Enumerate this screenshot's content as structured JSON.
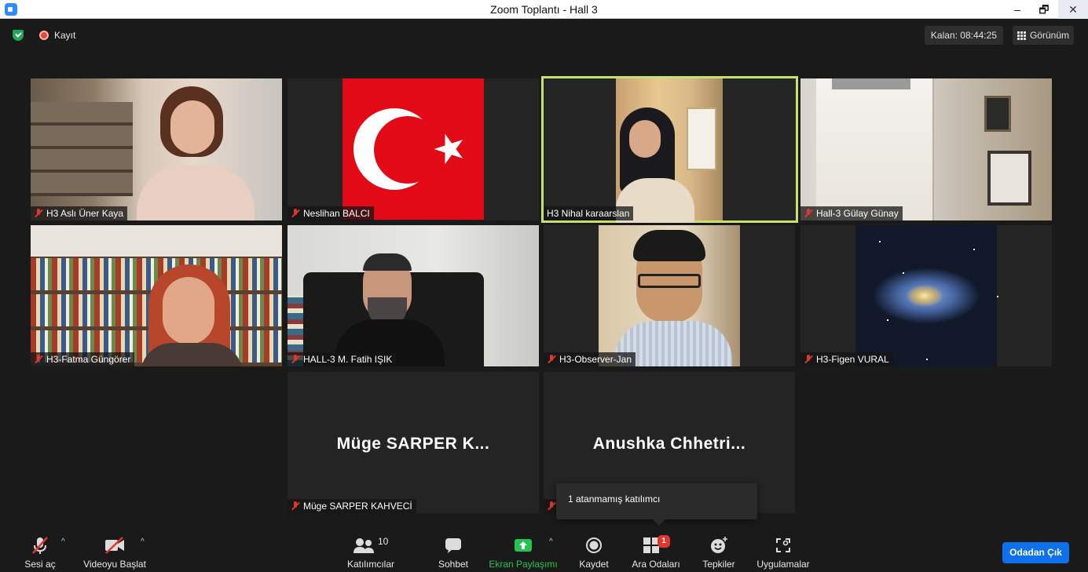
{
  "window": {
    "title": "Zoom Toplantı - Hall 3",
    "minimize_glyph": "–",
    "maximize_glyph": "🗗",
    "close_glyph": "✕"
  },
  "topbar": {
    "recording_label": "Kayıt",
    "timer": "Kalan: 08:44:25",
    "view_label": "Görünüm"
  },
  "participants": [
    {
      "label": "H3 Aslı Üner Kaya",
      "muted": true
    },
    {
      "label": "Neslihan BALCI",
      "muted": true
    },
    {
      "label": "H3 Nihal karaarslan",
      "muted": false,
      "active_speaker": true
    },
    {
      "label": "Hall-3 Gülay Günay",
      "muted": true
    },
    {
      "label": "H3-Fatma Güngörer",
      "muted": true
    },
    {
      "label": "HALL-3 M. Fatih IŞIK",
      "muted": true
    },
    {
      "label": "H3-Observer-Jan",
      "muted": true
    },
    {
      "label": "H3-Figen VURAL",
      "muted": true
    },
    {
      "label": "Müge SARPER KAHVECİ",
      "display_name": "Müge SARPER K...",
      "muted": true
    },
    {
      "label": "",
      "display_name": "Anushka  Chhetri...",
      "muted": true
    }
  ],
  "tooltip": {
    "text": "1 atanmamış katılımcı"
  },
  "toolbar": {
    "mute_label": "Sesi aç",
    "video_label": "Videoyu Başlat",
    "participants_label": "Katılımcılar",
    "participants_count": "10",
    "chat_label": "Sohbet",
    "share_label": "Ekran Paylaşımı",
    "record_label": "Kaydet",
    "breakout_label": "Ara Odaları",
    "breakout_badge": "1",
    "reactions_label": "Tepkiler",
    "apps_label": "Uygulamalar",
    "leave_label": "Odadan Çık",
    "caret_glyph": "^"
  },
  "colors": {
    "active_speaker_border": "#c6e16c",
    "share_green": "#23c552",
    "leave_blue": "#0e71eb",
    "mute_red": "#e0362c"
  }
}
